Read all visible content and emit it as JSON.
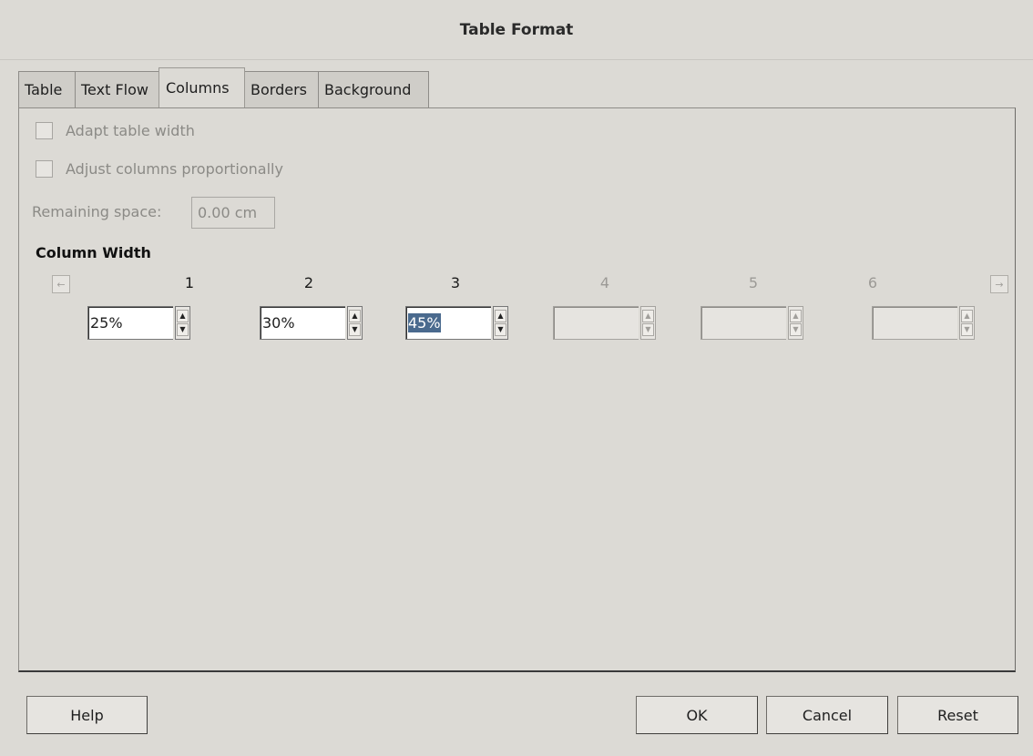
{
  "window": {
    "title": "Table Format"
  },
  "tabs": [
    {
      "label": "Table"
    },
    {
      "label": "Text Flow"
    },
    {
      "label": "Columns",
      "active": true
    },
    {
      "label": "Borders"
    },
    {
      "label": "Background"
    }
  ],
  "options": {
    "adapt_table_width": {
      "label": "Adapt table width",
      "checked": false,
      "enabled": false
    },
    "adjust_columns": {
      "label": "Adjust columns proportionally",
      "checked": false,
      "enabled": false
    }
  },
  "remaining_space": {
    "label": "Remaining space:",
    "value": "0.00 cm"
  },
  "column_width": {
    "heading": "Column Width",
    "columns": [
      {
        "number": "1",
        "value": "25%",
        "enabled": true
      },
      {
        "number": "2",
        "value": "30%",
        "enabled": true
      },
      {
        "number": "3",
        "value": "45%",
        "enabled": true,
        "selected": true
      },
      {
        "number": "4",
        "value": "",
        "enabled": false
      },
      {
        "number": "5",
        "value": "",
        "enabled": false
      },
      {
        "number": "6",
        "value": "",
        "enabled": false
      }
    ]
  },
  "buttons": {
    "help": "Help",
    "ok": "OK",
    "cancel": "Cancel",
    "reset": "Reset"
  },
  "icons": {
    "scroll_left": "arrow-left-icon",
    "scroll_right": "arrow-right-icon",
    "spin_up": "triangle-up-icon",
    "spin_down": "triangle-down-icon"
  },
  "colors": {
    "background": "#dcdad5",
    "selection": "#4a6a8e"
  }
}
